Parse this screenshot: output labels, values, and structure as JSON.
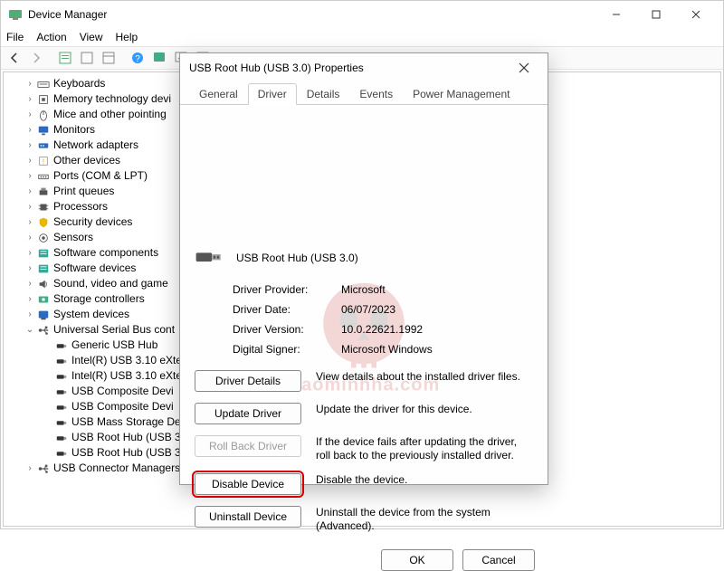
{
  "window": {
    "title": "Device Manager"
  },
  "menu": {
    "file": "File",
    "action": "Action",
    "view": "View",
    "help": "Help"
  },
  "tree": {
    "items": [
      {
        "level": 1,
        "twist": ">",
        "icon": "keyboard",
        "label": "Keyboards"
      },
      {
        "level": 1,
        "twist": ">",
        "icon": "chip",
        "label": "Memory technology devi"
      },
      {
        "level": 1,
        "twist": ">",
        "icon": "mouse",
        "label": "Mice and other pointing"
      },
      {
        "level": 1,
        "twist": ">",
        "icon": "monitor",
        "label": "Monitors"
      },
      {
        "level": 1,
        "twist": ">",
        "icon": "network",
        "label": "Network adapters"
      },
      {
        "level": 1,
        "twist": ">",
        "icon": "other",
        "label": "Other devices"
      },
      {
        "level": 1,
        "twist": ">",
        "icon": "ports",
        "label": "Ports (COM & LPT)"
      },
      {
        "level": 1,
        "twist": ">",
        "icon": "printer",
        "label": "Print queues"
      },
      {
        "level": 1,
        "twist": ">",
        "icon": "cpu",
        "label": "Processors"
      },
      {
        "level": 1,
        "twist": ">",
        "icon": "security",
        "label": "Security devices"
      },
      {
        "level": 1,
        "twist": ">",
        "icon": "sensor",
        "label": "Sensors"
      },
      {
        "level": 1,
        "twist": ">",
        "icon": "software",
        "label": "Software components"
      },
      {
        "level": 1,
        "twist": ">",
        "icon": "software",
        "label": "Software devices"
      },
      {
        "level": 1,
        "twist": ">",
        "icon": "sound",
        "label": "Sound, video and game"
      },
      {
        "level": 1,
        "twist": ">",
        "icon": "storage",
        "label": "Storage controllers"
      },
      {
        "level": 1,
        "twist": ">",
        "icon": "system",
        "label": "System devices"
      },
      {
        "level": 1,
        "twist": "v",
        "icon": "usb",
        "label": "Universal Serial Bus cont"
      },
      {
        "level": 2,
        "twist": "",
        "icon": "usb-dev",
        "label": "Generic USB Hub"
      },
      {
        "level": 2,
        "twist": "",
        "icon": "usb-dev",
        "label": "Intel(R) USB 3.10 eXte"
      },
      {
        "level": 2,
        "twist": "",
        "icon": "usb-dev",
        "label": "Intel(R) USB 3.10 eXte"
      },
      {
        "level": 2,
        "twist": "",
        "icon": "usb-dev",
        "label": "USB Composite Devi"
      },
      {
        "level": 2,
        "twist": "",
        "icon": "usb-dev",
        "label": "USB Composite Devi"
      },
      {
        "level": 2,
        "twist": "",
        "icon": "usb-dev",
        "label": "USB Mass Storage De"
      },
      {
        "level": 2,
        "twist": "",
        "icon": "usb-dev",
        "label": "USB Root Hub (USB 3."
      },
      {
        "level": 2,
        "twist": "",
        "icon": "usb-dev",
        "label": "USB Root Hub (USB 3.0)"
      },
      {
        "level": 1,
        "twist": ">",
        "icon": "usb",
        "label": "USB Connector Managers"
      }
    ]
  },
  "dialog": {
    "title": "USB Root Hub (USB 3.0) Properties",
    "tabs": {
      "general": "General",
      "driver": "Driver",
      "details": "Details",
      "events": "Events",
      "power": "Power Management"
    },
    "device_name": "USB Root Hub (USB 3.0)",
    "info": {
      "provider_k": "Driver Provider:",
      "provider_v": "Microsoft",
      "date_k": "Driver Date:",
      "date_v": "06/07/2023",
      "version_k": "Driver Version:",
      "version_v": "10.0.22621.1992",
      "signer_k": "Digital Signer:",
      "signer_v": "Microsoft Windows"
    },
    "buttons": {
      "details": "Driver Details",
      "details_desc": "View details about the installed driver files.",
      "update": "Update Driver",
      "update_desc": "Update the driver for this device.",
      "rollback": "Roll Back Driver",
      "rollback_desc": "If the device fails after updating the driver, roll back to the previously installed driver.",
      "disable": "Disable Device",
      "disable_desc": "Disable the device.",
      "uninstall": "Uninstall Device",
      "uninstall_desc": "Uninstall the device from the system (Advanced)."
    },
    "footer": {
      "ok": "OK",
      "cancel": "Cancel"
    }
  },
  "watermark": "Daominhha.com"
}
